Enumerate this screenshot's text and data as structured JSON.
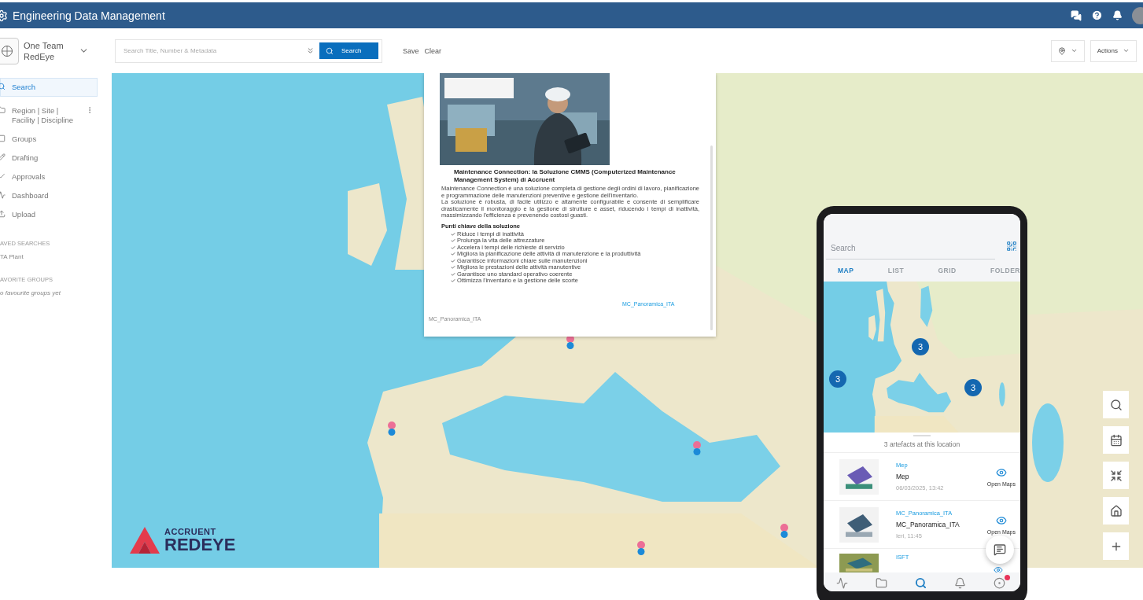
{
  "header": {
    "title": "Engineering Data Management"
  },
  "org": {
    "line1": "One Team",
    "line2": "RedEye"
  },
  "search": {
    "placeholder": "Search Title, Number & Metadata",
    "button": "Search"
  },
  "toolbar_links": [
    "Save",
    "Clear"
  ],
  "actions": {
    "label": "Actions"
  },
  "sidebar": {
    "items": [
      {
        "label": "Search",
        "selected": true,
        "menu": false
      },
      {
        "label": "Region | Site | Facility | Discipline",
        "selected": false,
        "menu": true
      },
      {
        "label": "Groups",
        "selected": false,
        "menu": false
      },
      {
        "label": "Drafting",
        "selected": false,
        "menu": false
      },
      {
        "label": "Approvals",
        "selected": false,
        "menu": false
      },
      {
        "label": "Dashboard",
        "selected": false,
        "menu": false
      },
      {
        "label": "Upload",
        "selected": false,
        "menu": false
      }
    ],
    "sections": [
      {
        "title": "AVED SEARCHES",
        "entries": [
          {
            "text": "TA Plant",
            "kind": "link"
          }
        ]
      },
      {
        "title": "AVORITE GROUPS",
        "entries": [
          {
            "text": "o favourite groups yet",
            "kind": "empty"
          }
        ]
      }
    ]
  },
  "popup": {
    "document": {
      "heading": "Maintenance Connection: la Soluzione CMMS (Computerized Maintenance Management System) di Accruent",
      "paragraphs": [
        "Maintenance Connection è una soluzione completa di gestione degli ordini di lavoro, pianificazione e programmazione delle manutenzioni preventive e gestione dell'inventario.",
        "La soluzione è robusta, di facile utilizzo e altamente configurabile e consente di semplificare drasticamente il monitoraggio e la gestione di strutture e asset, riducendo i tempi di inattività, massimizzando l'efficienza e prevenendo costosi guasti."
      ],
      "subheading": "Punti chiave della soluzione",
      "bullets": [
        "Riduce i tempi di inattività",
        "Prolunga la vita delle attrezzature",
        "Accelera i tempi delle richieste di servizio",
        "Migliora la pianificazione delle attività di manutenzione e la produttività",
        "Garantisce informazioni chiare sulle manutenzioni",
        "Migliora le prestazioni delle attività manutentive",
        "Garantisce uno standard operativo coerente",
        "Ottimizza l'inventario e la gestione delle scorte"
      ]
    },
    "link": "MC_Panoramica_ITA",
    "caption": "MC_Panoramica_ITA"
  },
  "logo": {
    "company": "ACCRUENT",
    "product": "REDEYE"
  },
  "phone": {
    "search_placeholder": "Search",
    "tabs": [
      {
        "label": "MAP",
        "selected": true
      },
      {
        "label": "LIST",
        "selected": false
      },
      {
        "label": "GRID",
        "selected": false
      },
      {
        "label": "FOLDER",
        "selected": false
      }
    ],
    "clusters": [
      "3",
      "3",
      "3"
    ],
    "sheet_title": "3 artefacts at this location",
    "items": [
      {
        "category": "Mep",
        "title": "Mep",
        "date": "06/03/2025, 13:42",
        "action": "Open Maps"
      },
      {
        "category": "MC_Panoramica_ITA",
        "title": "MC_Panoramica_ITA",
        "date": "Ieri, 11:45",
        "action": "Open Maps"
      },
      {
        "category": "ISFT"
      }
    ],
    "nav": [
      {
        "selected": false
      },
      {
        "selected": false
      },
      {
        "selected": true
      },
      {
        "selected": false
      },
      {
        "selected": false
      }
    ]
  }
}
